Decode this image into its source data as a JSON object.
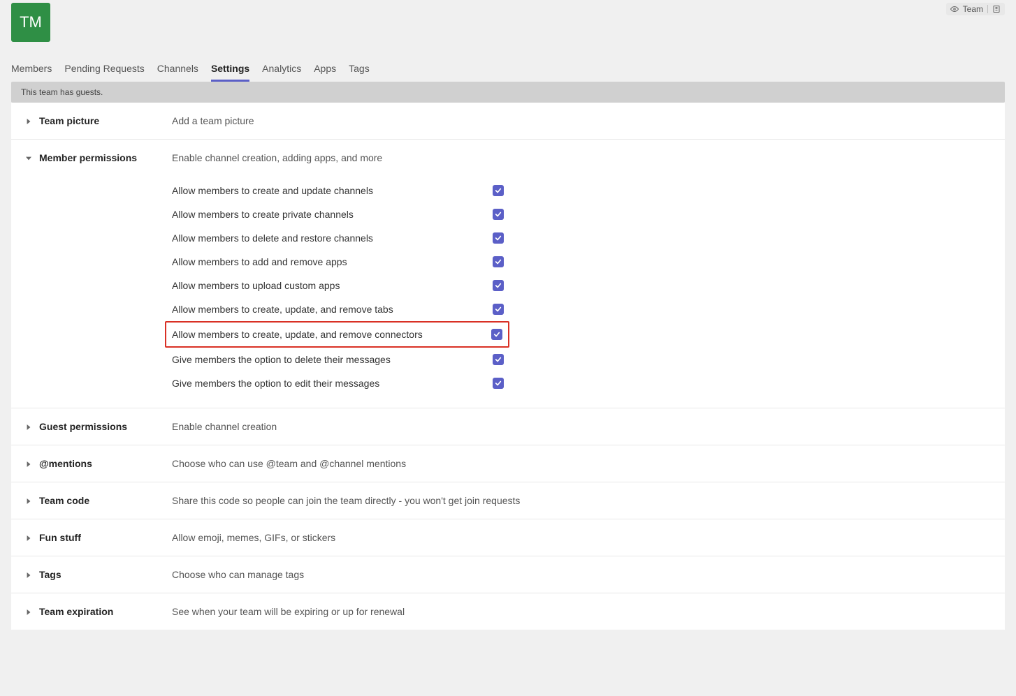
{
  "team": {
    "logo_initials": "TM",
    "pill_label": "Team"
  },
  "tabs": [
    {
      "id": "members",
      "label": "Members",
      "active": false
    },
    {
      "id": "pending",
      "label": "Pending Requests",
      "active": false
    },
    {
      "id": "channels",
      "label": "Channels",
      "active": false
    },
    {
      "id": "settings",
      "label": "Settings",
      "active": true
    },
    {
      "id": "analytics",
      "label": "Analytics",
      "active": false
    },
    {
      "id": "apps",
      "label": "Apps",
      "active": false
    },
    {
      "id": "tags",
      "label": "Tags",
      "active": false
    }
  ],
  "banner": "This team has guests.",
  "sections": {
    "team_picture": {
      "title": "Team picture",
      "desc": "Add a team picture"
    },
    "member_permissions": {
      "title": "Member permissions",
      "desc": "Enable channel creation, adding apps, and more",
      "items": [
        {
          "label": "Allow members to create and update channels",
          "checked": true,
          "highlight": false
        },
        {
          "label": "Allow members to create private channels",
          "checked": true,
          "highlight": false
        },
        {
          "label": "Allow members to delete and restore channels",
          "checked": true,
          "highlight": false
        },
        {
          "label": "Allow members to add and remove apps",
          "checked": true,
          "highlight": false
        },
        {
          "label": "Allow members to upload custom apps",
          "checked": true,
          "highlight": false
        },
        {
          "label": "Allow members to create, update, and remove tabs",
          "checked": true,
          "highlight": false
        },
        {
          "label": "Allow members to create, update, and remove connectors",
          "checked": true,
          "highlight": true
        },
        {
          "label": "Give members the option to delete their messages",
          "checked": true,
          "highlight": false
        },
        {
          "label": "Give members the option to edit their messages",
          "checked": true,
          "highlight": false
        }
      ]
    },
    "guest_permissions": {
      "title": "Guest permissions",
      "desc": "Enable channel creation"
    },
    "mentions": {
      "title": "@mentions",
      "desc": "Choose who can use @team and @channel mentions"
    },
    "team_code": {
      "title": "Team code",
      "desc": "Share this code so people can join the team directly - you won't get join requests"
    },
    "fun_stuff": {
      "title": "Fun stuff",
      "desc": "Allow emoji, memes, GIFs, or stickers"
    },
    "tags_section": {
      "title": "Tags",
      "desc": "Choose who can manage tags"
    },
    "team_expiration": {
      "title": "Team expiration",
      "desc": "See when your team will be expiring or up for renewal"
    }
  }
}
